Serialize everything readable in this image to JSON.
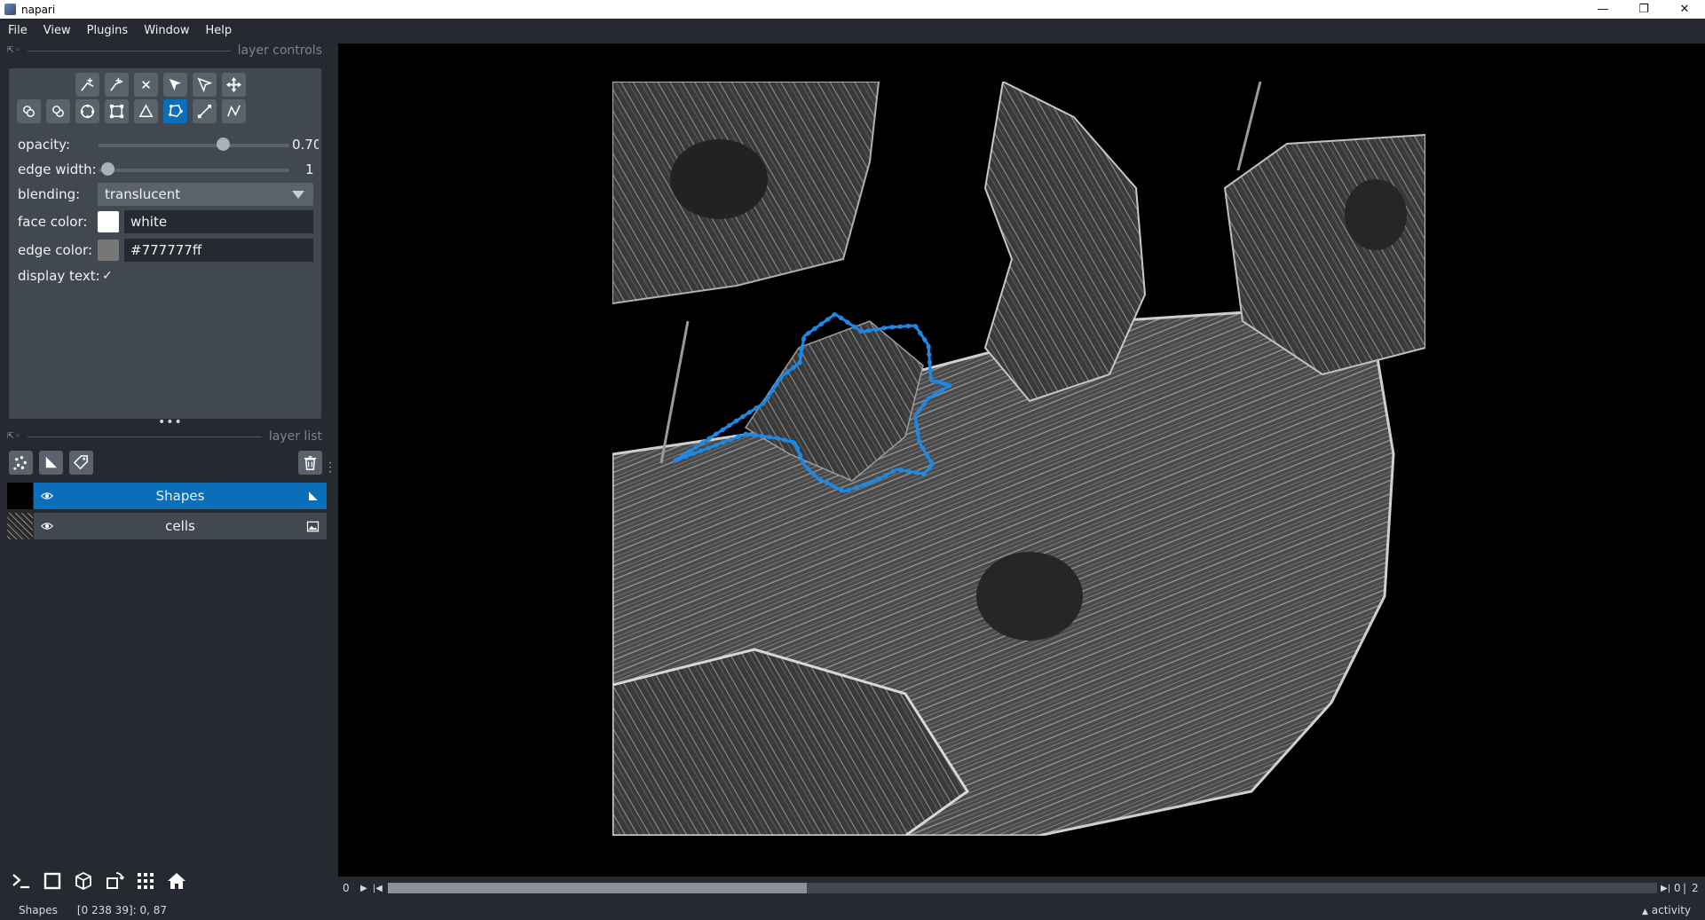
{
  "window": {
    "title": "napari",
    "controls": [
      "—",
      "❐",
      "✕"
    ]
  },
  "menu": {
    "items": [
      "File",
      "View",
      "Plugins",
      "Window",
      "Help"
    ]
  },
  "layer_controls": {
    "title": "layer controls",
    "opacity_label": "opacity:",
    "opacity_value": "0.70",
    "opacity_fraction": 0.7,
    "edge_width_label": "edge width:",
    "edge_width_value": "1",
    "blending_label": "blending:",
    "blending_value": "translucent",
    "face_color_label": "face color:",
    "face_color_value": "white",
    "face_color_hex": "#ffffff",
    "edge_color_label": "edge color:",
    "edge_color_value": "#777777ff",
    "edge_color_hex": "#777777",
    "display_text_label": "display text:",
    "display_text_checked": "✓"
  },
  "layer_list": {
    "title": "layer list",
    "layers": [
      {
        "name": "Shapes",
        "selected": true,
        "type_icon": "shapes-icon"
      },
      {
        "name": "cells",
        "selected": false,
        "type_icon": "image-icon"
      }
    ]
  },
  "dims": {
    "current": "0",
    "slider_fraction": 0.33,
    "position": "0",
    "max": "2"
  },
  "status": {
    "layer": "Shapes",
    "coords": "[0 238 39]: 0, 87",
    "activity": "activity"
  },
  "colors": {
    "accent": "#0a6eb9",
    "polygon": "#1e88e5",
    "background": "#262930",
    "panel": "#414851"
  }
}
